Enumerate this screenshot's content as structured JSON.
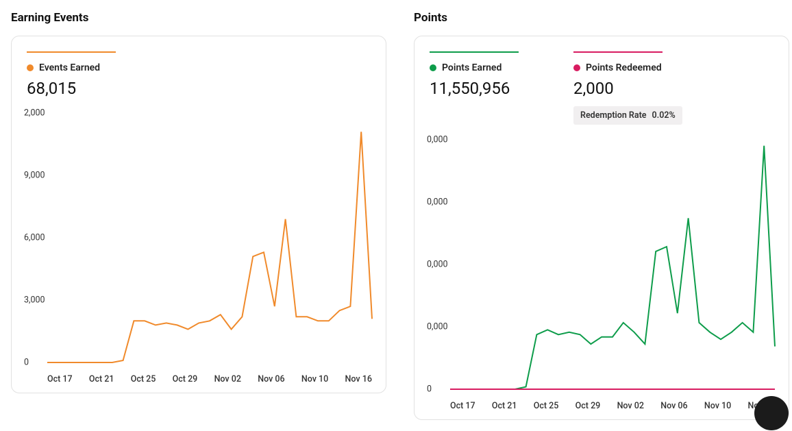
{
  "left": {
    "title": "Earning Events",
    "series": [
      {
        "label": "Events Earned",
        "color": "#f08a2b",
        "value": "68,015"
      }
    ],
    "yticks": [
      "0",
      "3,000",
      "6,000",
      "9,000",
      "2,000"
    ],
    "xticks": [
      "Oct 17",
      "Oct 21",
      "Oct 25",
      "Oct 29",
      "Nov 02",
      "Nov 06",
      "Nov 10",
      "Nov 16"
    ]
  },
  "right": {
    "title": "Points",
    "series": [
      {
        "label": "Points Earned",
        "color": "#0d9c4a",
        "value": "11,550,956"
      },
      {
        "label": "Points Redeemed",
        "color": "#d81b60",
        "value": "2,000"
      }
    ],
    "badge": {
      "label": "Redemption Rate",
      "value": "0.02%"
    },
    "yticks": [
      "0",
      "0,000",
      "0,000",
      "0,000",
      "0,000"
    ],
    "xticks": [
      "Oct 17",
      "Oct 21",
      "Oct 25",
      "Oct 29",
      "Nov 02",
      "Nov 06",
      "Nov 10",
      "Nov 16"
    ]
  },
  "chart_data": [
    {
      "type": "line",
      "title": "Earning Events",
      "ylabel": "Events Earned",
      "ylim": [
        0,
        12000
      ],
      "x": [
        "Oct 17",
        "Oct 18",
        "Oct 19",
        "Oct 20",
        "Oct 21",
        "Oct 22",
        "Oct 23",
        "Oct 24",
        "Oct 25",
        "Oct 26",
        "Oct 27",
        "Oct 28",
        "Oct 29",
        "Oct 30",
        "Oct 31",
        "Nov 01",
        "Nov 02",
        "Nov 03",
        "Nov 04",
        "Nov 05",
        "Nov 06",
        "Nov 07",
        "Nov 08",
        "Nov 09",
        "Nov 10",
        "Nov 11",
        "Nov 12",
        "Nov 13",
        "Nov 14",
        "Nov 15",
        "Nov 16"
      ],
      "series": [
        {
          "name": "Events Earned",
          "color": "#f08a2b",
          "values": [
            0,
            0,
            0,
            0,
            0,
            0,
            0,
            100,
            2000,
            2000,
            1800,
            1900,
            1800,
            1600,
            1900,
            2000,
            2300,
            1600,
            2200,
            5100,
            5300,
            2700,
            6900,
            2200,
            2200,
            2000,
            2000,
            2500,
            2700,
            11100,
            2100
          ]
        }
      ]
    },
    {
      "type": "line",
      "title": "Points",
      "ylim": [
        0,
        2100000
      ],
      "x": [
        "Oct 17",
        "Oct 18",
        "Oct 19",
        "Oct 20",
        "Oct 21",
        "Oct 22",
        "Oct 23",
        "Oct 24",
        "Oct 25",
        "Oct 26",
        "Oct 27",
        "Oct 28",
        "Oct 29",
        "Oct 30",
        "Oct 31",
        "Nov 01",
        "Nov 02",
        "Nov 03",
        "Nov 04",
        "Nov 05",
        "Nov 06",
        "Nov 07",
        "Nov 08",
        "Nov 09",
        "Nov 10",
        "Nov 11",
        "Nov 12",
        "Nov 13",
        "Nov 14",
        "Nov 15",
        "Nov 16"
      ],
      "series": [
        {
          "name": "Points Earned",
          "color": "#0d9c4a",
          "values": [
            0,
            0,
            0,
            0,
            0,
            0,
            0,
            20000,
            460000,
            500000,
            460000,
            480000,
            460000,
            380000,
            440000,
            440000,
            560000,
            480000,
            380000,
            1160000,
            1200000,
            640000,
            1440000,
            560000,
            480000,
            420000,
            480000,
            560000,
            480000,
            2050000,
            360000
          ]
        },
        {
          "name": "Points Redeemed",
          "color": "#d81b60",
          "values": [
            0,
            0,
            0,
            0,
            0,
            0,
            0,
            0,
            0,
            0,
            0,
            0,
            0,
            0,
            0,
            0,
            0,
            0,
            0,
            0,
            0,
            0,
            0,
            0,
            0,
            0,
            0,
            0,
            0,
            0,
            0
          ]
        }
      ]
    }
  ]
}
